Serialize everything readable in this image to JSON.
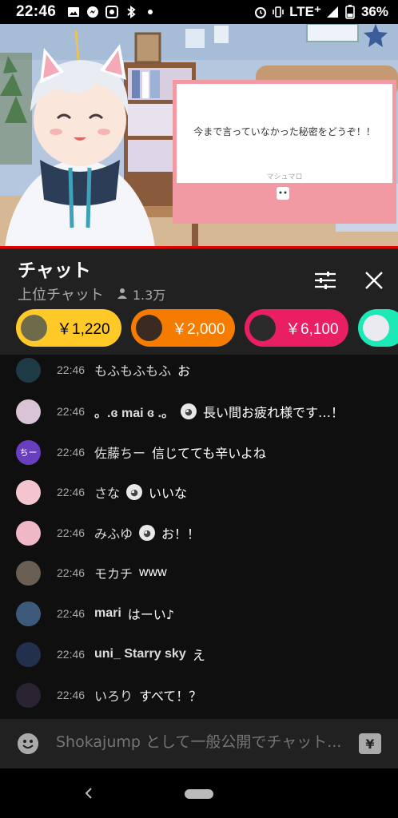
{
  "status_bar": {
    "time": "22:46",
    "network": "LTE⁺",
    "battery": "36%"
  },
  "video": {
    "marshmallow_text": "今まで言っていなかった秘密をどうぞ！！",
    "marshmallow_brand": "マシュマロ"
  },
  "chat_header": {
    "title": "チャット",
    "mode": "上位チャット",
    "viewers": "1.3万"
  },
  "tickers": [
    {
      "amount": "￥1,220",
      "color": "#ffca28",
      "text_color": "#000000"
    },
    {
      "amount": "￥2,000",
      "color": "#f57c00",
      "text_color": "#ffffff"
    },
    {
      "amount": "￥6,100",
      "color": "#e91e63",
      "text_color": "#ffffff"
    },
    {
      "amount": "",
      "color": "#1de9b6",
      "text_color": "#000000"
    }
  ],
  "messages": [
    {
      "time": "22:46",
      "author": "もふもふもふ",
      "text": "お",
      "avatar_color": "#1d3a45"
    },
    {
      "time": "22:46",
      "author": "。.ɞ mai ɞ .。",
      "emote": true,
      "text": "長い間お疲れ様です…！",
      "avatar_color": "#d9c3d6"
    },
    {
      "time": "22:46",
      "author": "佐藤ちー",
      "text": "信じてても辛いよね",
      "avatar_color": "#6a3fbf",
      "avatar_text": "ちー"
    },
    {
      "time": "22:46",
      "author": "さな",
      "emote": true,
      "text": "いいな",
      "avatar_color": "#f3c6cf"
    },
    {
      "time": "22:46",
      "author": "みふゆ",
      "emote": true,
      "text": "お！！",
      "avatar_color": "#f0b8c6"
    },
    {
      "time": "22:46",
      "author": "モカチ",
      "text": "www",
      "avatar_color": "#6b5f53"
    },
    {
      "time": "22:46",
      "author": "mari",
      "text": "はーい♪",
      "avatar_color": "#3d5a7a"
    },
    {
      "time": "22:46",
      "author": "uni_ Starry sky",
      "text": "え",
      "avatar_color": "#23304d"
    },
    {
      "time": "22:46",
      "author": "いろり",
      "text": "すべて！？",
      "avatar_color": "#2a2432"
    }
  ],
  "input": {
    "placeholder": "Shokajump として一般公開でチャット..."
  }
}
